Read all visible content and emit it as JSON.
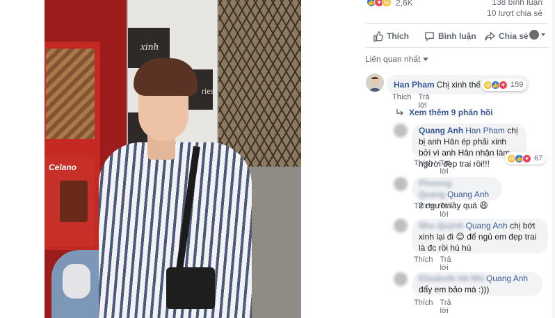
{
  "post": {
    "reaction_count": "2,6K",
    "comment_count": "138 bình luận",
    "share_count": "10 lượt chia sẻ",
    "actions": {
      "like": "Thích",
      "comment": "Bình luận",
      "share": "Chia sẻ"
    }
  },
  "photo": {
    "sign_text": "Celano",
    "poster_text": "xinh",
    "poster_text2": "ries"
  },
  "sort": {
    "label": "Liên quan nhất"
  },
  "comments": [
    {
      "author": "Han Pham",
      "text": "Chị xinh thế ạ",
      "like_label": "Thích",
      "reply_label": "Trả lời",
      "reactions": [
        "haha",
        "like",
        "love"
      ],
      "reaction_count": "159"
    }
  ],
  "more_replies": {
    "label": "Xem thêm 9 phản hồi"
  },
  "replies": [
    {
      "author": "Quang Anh",
      "tag": "Han Pham",
      "text": "chị bị anh Hân ép phải xinh bởi vì anh Hân nhận làm người đẹp trai rồi!!!",
      "like_label": "Thích",
      "reply_label": "Trả lời",
      "reactions": [
        "haha",
        "like",
        "love"
      ],
      "reaction_count": "67"
    },
    {
      "author": "Phương Quang",
      "tag": "Quang Anh",
      "text": "2 người lầy quá",
      "like_label": "Thích",
      "reply_label": "Trả lời"
    },
    {
      "author": "Nhu Quỳnh",
      "tag": "Quang Anh",
      "text": "chị bớt xinh lại đi",
      "text2": "để ngủ em đẹp trai là đc rồi hú hú",
      "like_label": "Thích",
      "reply_label": "Trả lời"
    },
    {
      "author": "Elizabeth Hà Nhi",
      "tag": "Quang Anh",
      "text": "đẩy em bảo mà :)))",
      "like_label": "Thích",
      "reply_label": "Trả lời"
    }
  ],
  "colors": {
    "link": "#385898",
    "muted": "#606770",
    "bubble": "#f2f3f5",
    "like_blue": "#2078f4",
    "love_red": "#f33e58",
    "haha_yellow": "#f7b928"
  },
  "icons": {
    "like": "thumbs-up-icon",
    "comment": "speech-bubble-icon",
    "share": "share-arrow-icon",
    "reply_arrow": "reply-arrow-icon",
    "caret": "caret-down-icon"
  }
}
